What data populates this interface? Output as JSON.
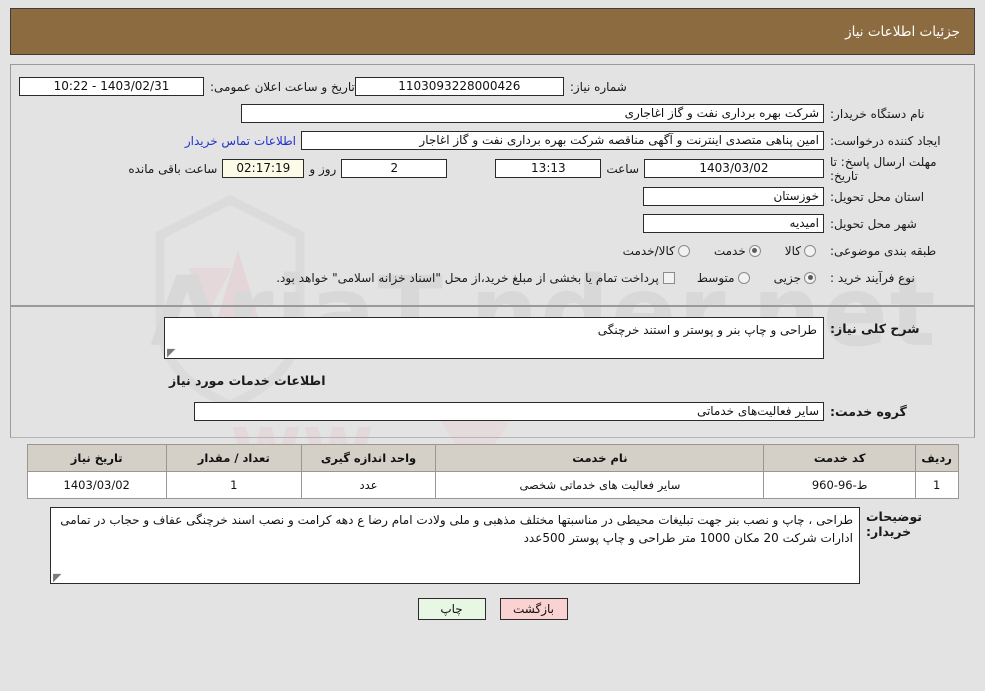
{
  "header": {
    "title": "جزئیات اطلاعات نیاز"
  },
  "colors": {
    "header_bar": "#8d6b41",
    "page_bg": "#e3e3e3",
    "table_header": "#d4d0c8",
    "link": "#2233cc",
    "print_button": "#e7f7e4",
    "back_button": "#fbd2d2",
    "countdown_field": "#fbfbe8"
  },
  "top_form": {
    "need_number_label": "شماره نیاز:",
    "need_number_value": "1103093228000426",
    "announce_datetime_label": "تاریخ و ساعت اعلان عمومی:",
    "announce_datetime_value": "1403/02/31 - 10:22",
    "buyer_org_label": "نام دستگاه خریدار:",
    "buyer_org_value": "شرکت بهره برداری نفت و گاز اغاجاری",
    "creator_label": "ایجاد کننده درخواست:",
    "creator_value": "امین پناهی متصدی اینترنت و آگهی مناقصه شرکت بهره برداری نفت و گاز اغاجار",
    "contact_link": "اطلاعات تماس خریدار",
    "deadline_label": "مهلت ارسال پاسخ: تا تاریخ:",
    "deadline_date": "1403/03/02",
    "deadline_hour_label": "ساعت",
    "deadline_time": "13:13",
    "remaining_days": "2",
    "remaining_days_text": "روز و",
    "remaining_clock": "02:17:19",
    "remaining_suffix": "ساعت باقی مانده",
    "province_label": "استان محل تحویل:",
    "province_value": "خوزستان",
    "city_label": "شهر محل تحویل:",
    "city_value": "امیدیه",
    "category_label": "طبقه بندی موضوعی:",
    "category_options": [
      {
        "label": "کالا",
        "selected": false
      },
      {
        "label": "خدمت",
        "selected": true
      },
      {
        "label": "کالا/خدمت",
        "selected": false
      }
    ],
    "process_label": "نوع فرآیند خرید :",
    "process_options": [
      {
        "label": "جزیی",
        "selected": true
      },
      {
        "label": "متوسط",
        "selected": false
      }
    ],
    "treasury_checkbox_text": "پرداخت تمام یا بخشی از مبلغ خرید،از محل \"اسناد خزانه اسلامی\" خواهد بود."
  },
  "description": {
    "label": "شرح کلی نیاز:",
    "value": "طراحی و چاپ بنر و  پوستر و استند خرچنگی"
  },
  "services_section": {
    "heading": "اطلاعات خدمات مورد نیاز",
    "group_label": "گروه خدمت:",
    "group_value": "سایر فعالیت‌های خدماتی"
  },
  "table": {
    "columns": [
      "ردیف",
      "کد خدمت",
      "نام خدمت",
      "واحد اندازه گیری",
      "تعداد / مقدار",
      "تاریخ نیاز"
    ],
    "rows": [
      {
        "radif": "1",
        "code": "ط-96-960",
        "name": "سایر فعالیت های خدماتی شخصی",
        "unit": "عدد",
        "qty": "1",
        "date": "1403/03/02"
      }
    ]
  },
  "buyer_notes": {
    "label": "توضیحات خریدار:",
    "value": "طراحی ، چاپ و نصب بنر  جهت تبلیغات محیطی در مناسبتها مختلف مذهبی و ملی ولادت امام رضا ع  دهه کرامت  و نصب اسند خرچنگی  عفاف  و حجاب در تمامی ادارات  شرکت 20 مکان  1000 متر طراحی و چاپ پوستر 500عدد"
  },
  "buttons": {
    "print": "چاپ",
    "back": "بازگشت"
  },
  "watermark": {
    "text": "AriaTender.net"
  }
}
